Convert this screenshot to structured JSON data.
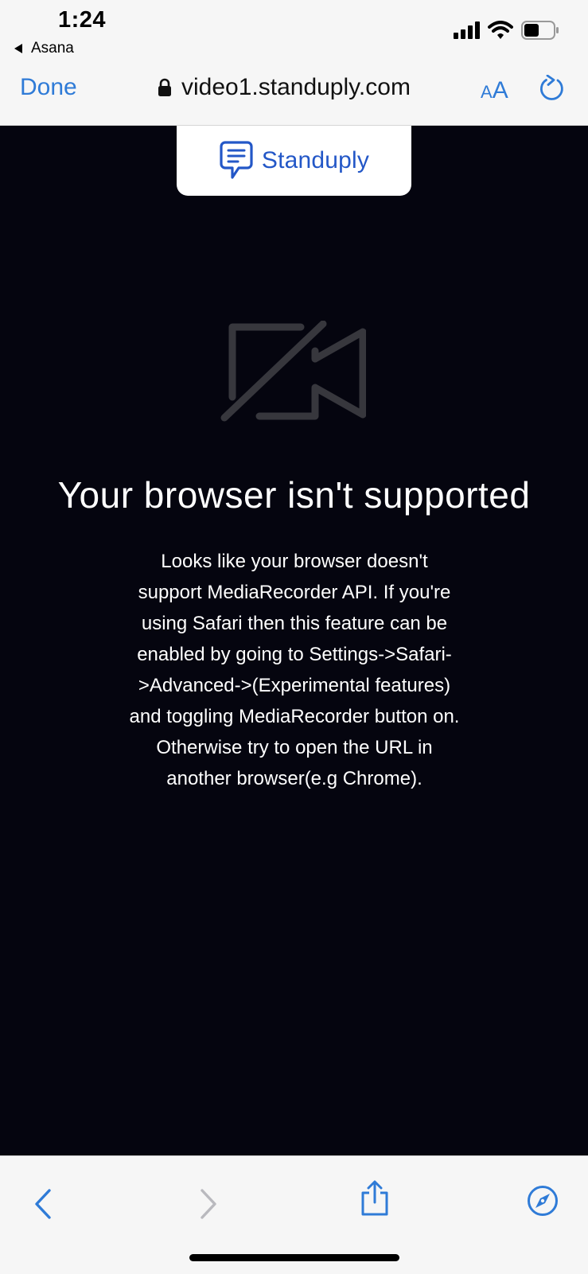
{
  "status_bar": {
    "time": "1:24",
    "back_app": "Asana",
    "icons": [
      "cellular-signal-icon",
      "wifi-icon",
      "battery-icon"
    ]
  },
  "nav_bar": {
    "done_label": "Done",
    "url": "video1.standuply.com",
    "aa_small": "A",
    "aa_big": "A",
    "icons": [
      "lock-icon",
      "reload-icon"
    ]
  },
  "logo": {
    "text": "Standuply",
    "icon": "standuply-logo-icon"
  },
  "message": {
    "icon": "video-off-icon",
    "title": "Your browser isn't supported",
    "lines": [
      "Looks like your browser doesn't",
      "support MediaRecorder API. If you're",
      "using Safari then this feature can be",
      "enabled by going to Settings->Safari-",
      ">Advanced->(Experimental features)",
      "and toggling MediaRecorder button on.",
      "Otherwise try to open the URL in",
      "another browser(e.g Chrome)."
    ]
  },
  "toolbar": {
    "icons": [
      "back-arrow-icon",
      "forward-arrow-icon",
      "share-icon",
      "compass-icon"
    ]
  },
  "colors": {
    "accent": "#2f7bd7",
    "brand": "#2357c7",
    "page_bg": "#05050f",
    "chrome_bg": "#f6f6f6",
    "icon_gray": "#37373d"
  }
}
